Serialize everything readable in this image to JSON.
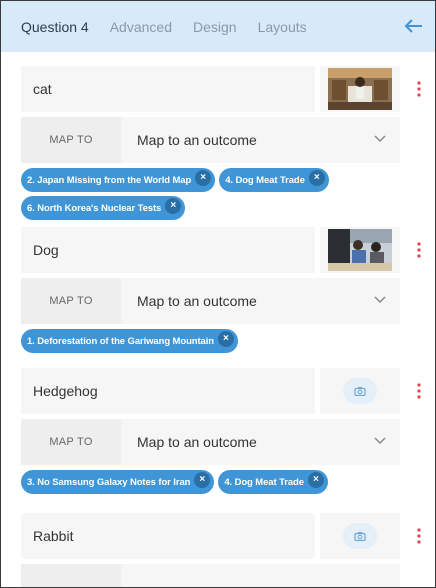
{
  "tabs": [
    {
      "label": "Question 4",
      "active": true
    },
    {
      "label": "Advanced",
      "active": false
    },
    {
      "label": "Design",
      "active": false
    },
    {
      "label": "Layouts",
      "active": false
    }
  ],
  "back_icon": "arrow-left-icon",
  "colors": {
    "accent": "#3f95d6",
    "header_bg": "#d8eaf9",
    "kebab": "#e0434f"
  },
  "answers": [
    {
      "text": "cat",
      "has_image": true,
      "map_label": "MAP TO",
      "map_value": "Map to an outcome",
      "tags": [
        {
          "label": "2. Japan Missing from the World Map",
          "remove": "×"
        },
        {
          "label": "4. Dog Meat Trade",
          "remove": "×"
        },
        {
          "label": "6. North Korea's Nuclear Tests",
          "remove": "×"
        }
      ]
    },
    {
      "text": "Dog",
      "has_image": true,
      "map_label": "MAP TO",
      "map_value": "Map to an outcome",
      "tags": [
        {
          "label": "1. Deforestation of the Gariwang Mountain",
          "remove": "×"
        }
      ]
    },
    {
      "text": "Hedgehog",
      "has_image": false,
      "map_label": "MAP TO",
      "map_value": "Map to an outcome",
      "tags": [
        {
          "label": "3. No Samsung Galaxy Notes for Iran",
          "remove": "×"
        },
        {
          "label": "4. Dog Meat Trade",
          "remove": "×"
        }
      ]
    },
    {
      "text": "Rabbit",
      "has_image": false
    }
  ]
}
